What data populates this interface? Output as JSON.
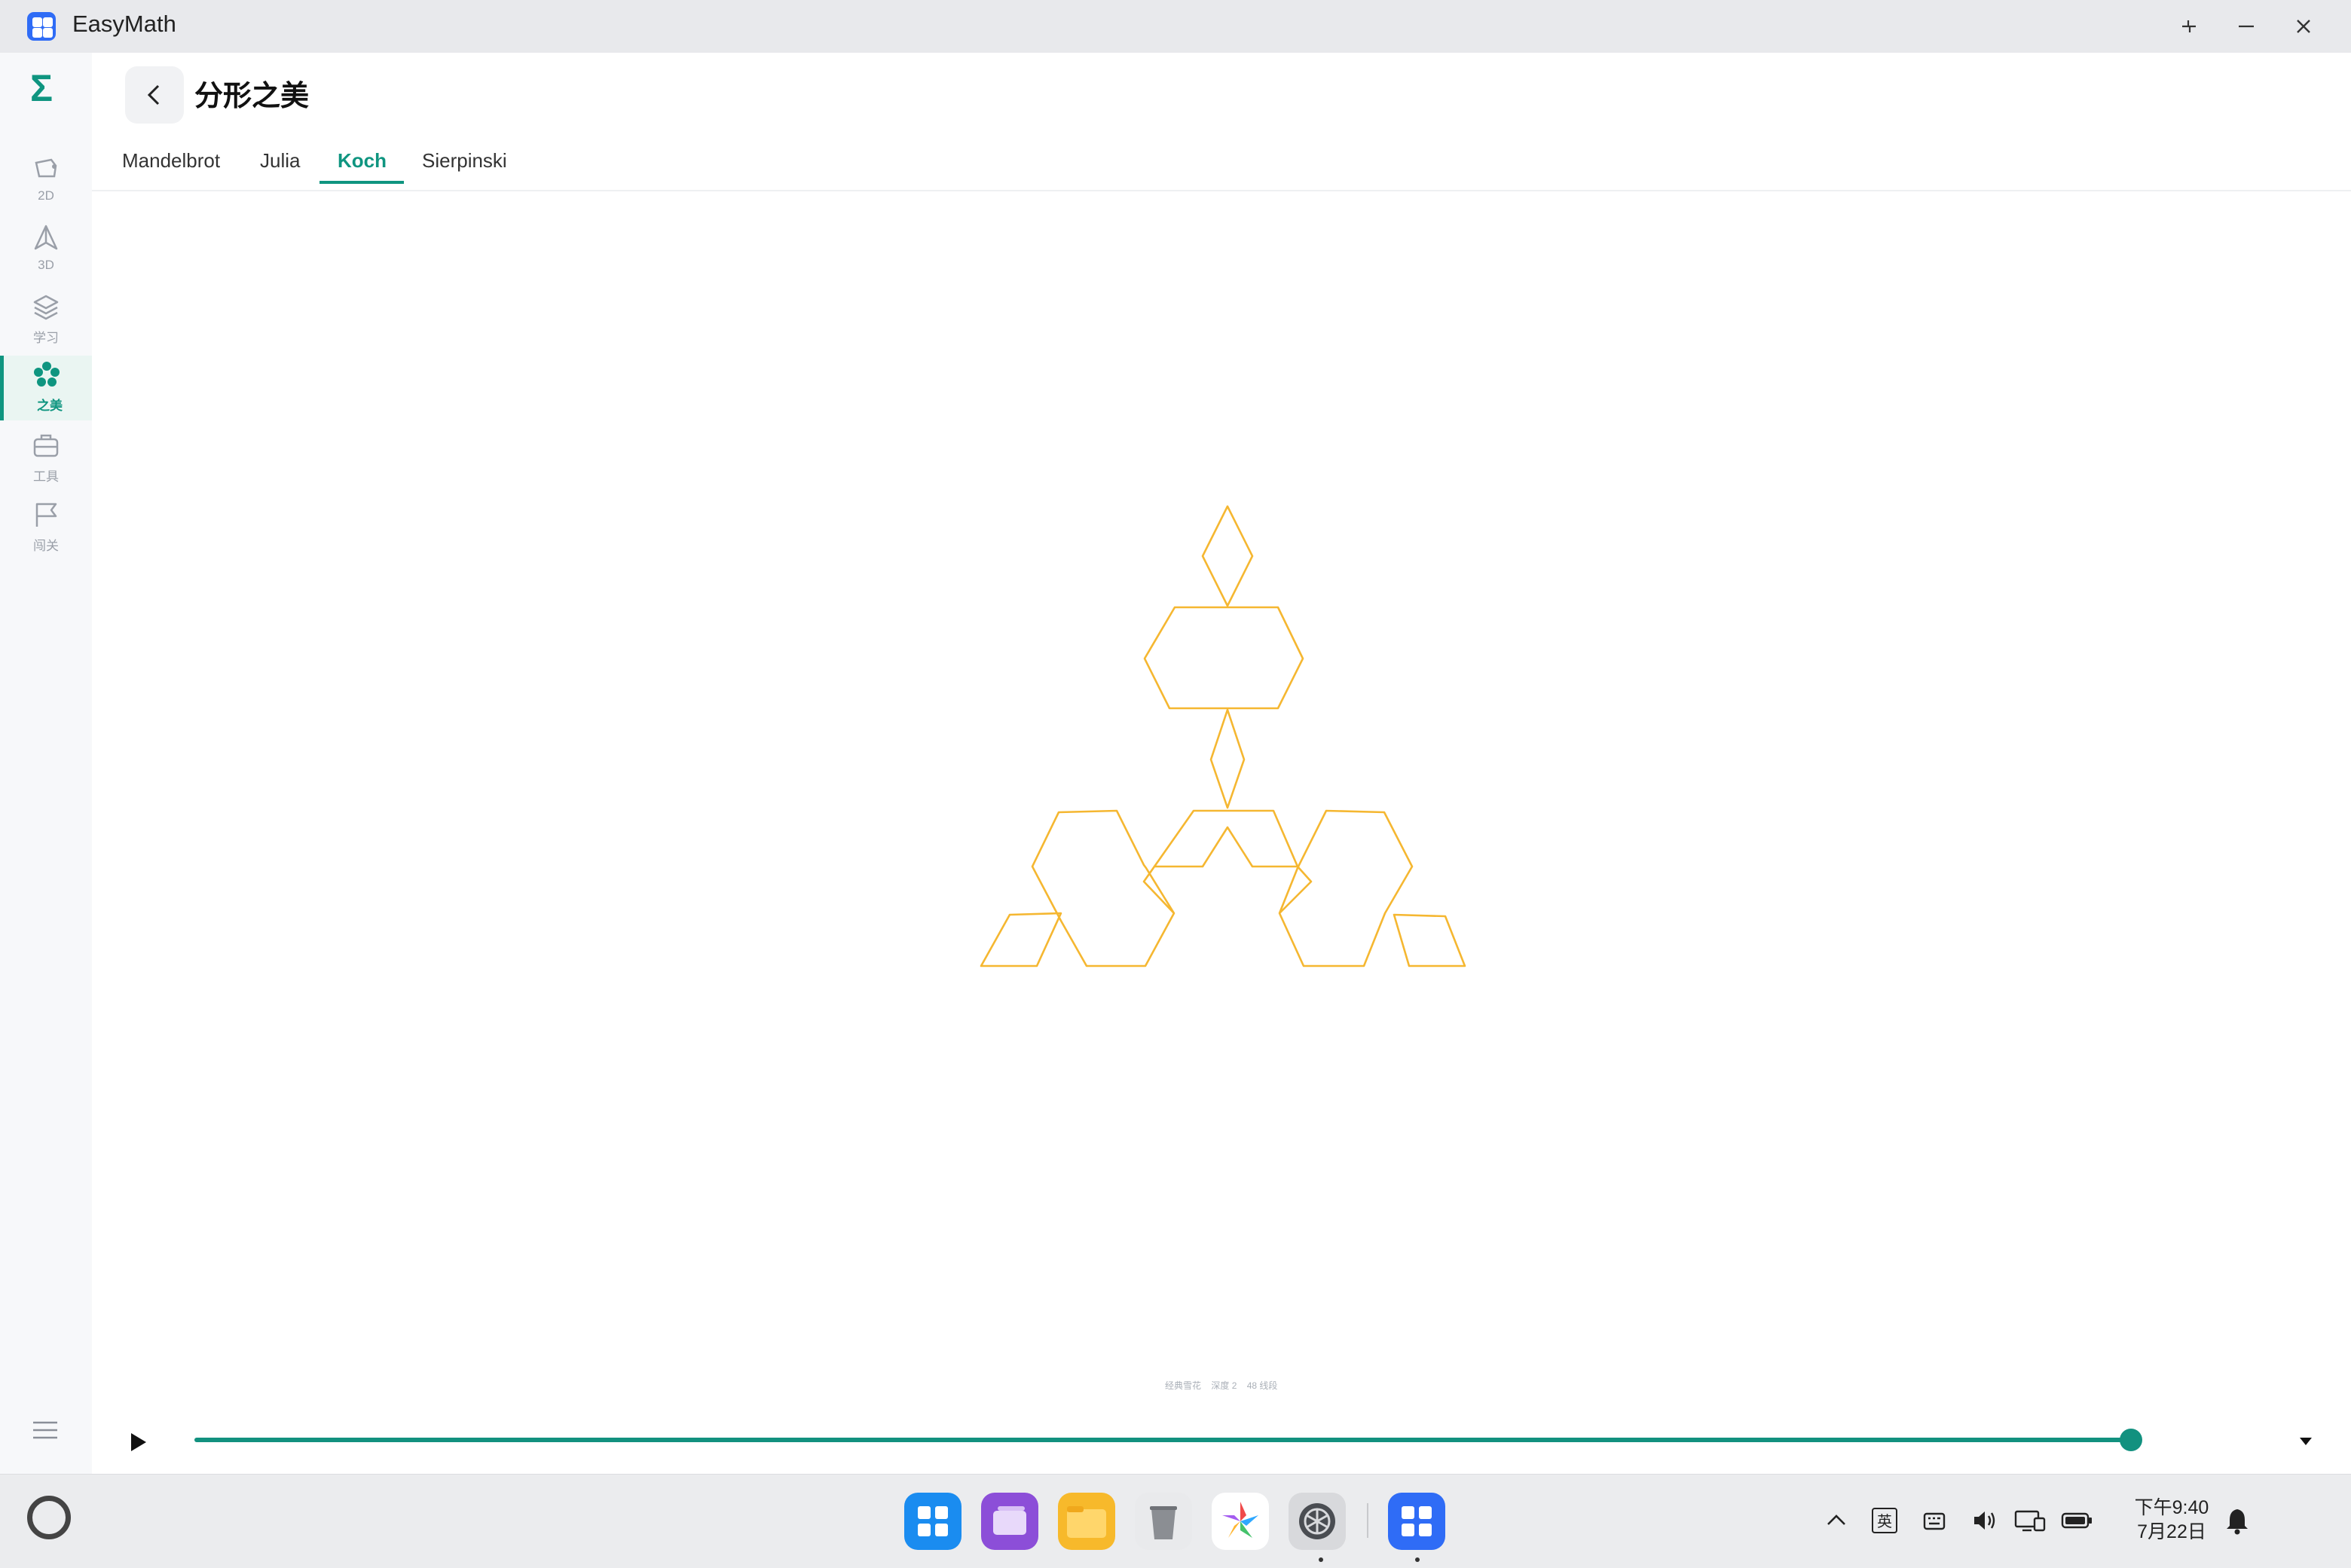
{
  "app": {
    "title": "EasyMath"
  },
  "sidebar": {
    "logo": "Σ",
    "items": [
      {
        "label": "2D",
        "icon": "shape-2d-icon"
      },
      {
        "label": "3D",
        "icon": "shape-3d-icon"
      },
      {
        "label": "学习",
        "icon": "layers-icon"
      },
      {
        "label": "之美",
        "icon": "flower-icon",
        "active": true
      },
      {
        "label": "工具",
        "icon": "toolbox-icon"
      },
      {
        "label": "闯关",
        "icon": "flag-icon"
      }
    ]
  },
  "header": {
    "title": "分形之美"
  },
  "tabs": [
    {
      "label": "Mandelbrot",
      "active": false
    },
    {
      "label": "Julia",
      "active": false
    },
    {
      "label": "Koch",
      "active": true
    },
    {
      "label": "Sierpinski",
      "active": false
    }
  ],
  "canvas": {
    "caption": [
      "经典雪花",
      "深度 2",
      "48 线段"
    ],
    "stroke_color": "#f5b731"
  },
  "playback": {
    "progress": 1.0
  },
  "taskbar": {
    "ime": "英",
    "time": "下午9:40",
    "date": "7月22日"
  },
  "colors": {
    "accent": "#0f9580",
    "fractal": "#f5b731",
    "app_icon": "#2f6cf6"
  }
}
